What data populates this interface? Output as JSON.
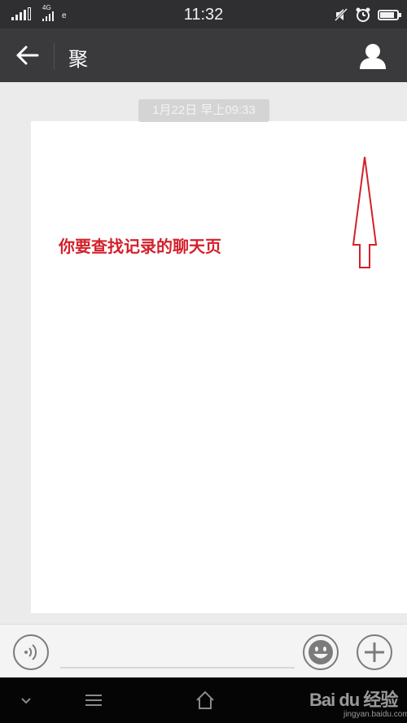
{
  "status_bar": {
    "network": "4G",
    "carrier_mark": "e",
    "time": "11:32",
    "battery_level": 0.85
  },
  "header": {
    "title": "聚"
  },
  "chat": {
    "timestamp": "1月22日 早上09:33",
    "annotation": "你要查找记录的聊天页",
    "annotation_color": "#d4202a"
  },
  "watermark": {
    "logo": "Bai du 经验",
    "url": "jingyan.baidu.com"
  },
  "icons": {
    "back": "arrow-left-icon",
    "profile": "person-icon",
    "voice": "voice-icon",
    "emoji": "emoji-icon",
    "plus": "plus-icon"
  }
}
